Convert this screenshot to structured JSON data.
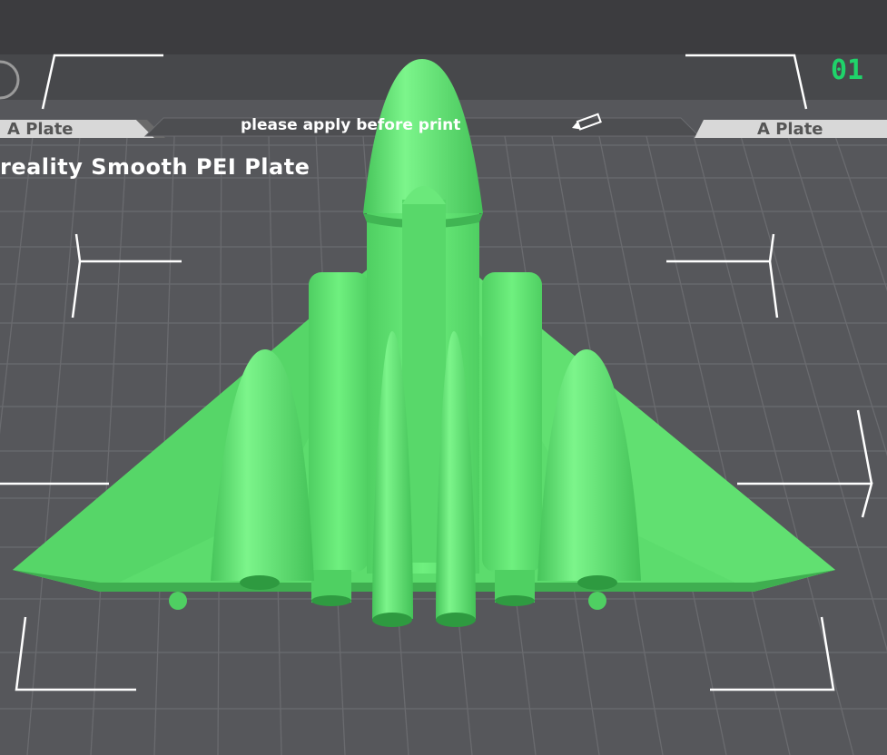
{
  "viewport": {
    "plate_type": "reality Smooth PEI Plate",
    "plate_number": "01",
    "notice": "please apply before print",
    "left_tab_label": "A Plate",
    "right_tab_label": "A Plate"
  },
  "colors": {
    "bed": "#56575b",
    "grid": "#6b6c70",
    "model": "#5ddf6f",
    "accent": "#1fd36a",
    "corner_marks": "#ffffff"
  },
  "icons": {
    "edit": "pencil-icon",
    "plate_settings": "plate-settings-icon"
  }
}
